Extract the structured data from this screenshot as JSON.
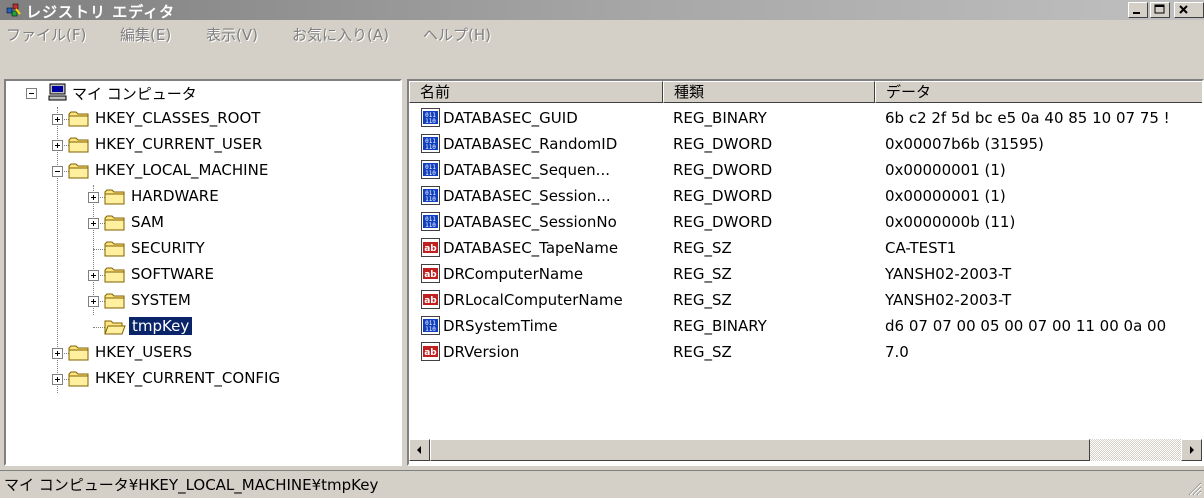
{
  "window": {
    "title": "レジストリ エディタ",
    "controls": {
      "minimize": "minimize",
      "maximize": "maximize",
      "close": "close"
    }
  },
  "menu": [
    {
      "label": "ファイル(F)"
    },
    {
      "label": "編集(E)"
    },
    {
      "label": "表示(V)"
    },
    {
      "label": "お気に入り(A)"
    },
    {
      "label": "ヘルプ(H)"
    }
  ],
  "tree": {
    "root": "マイ コンピュータ",
    "nodes": [
      {
        "label": "HKEY_CLASSES_ROOT",
        "expander": "plus"
      },
      {
        "label": "HKEY_CURRENT_USER",
        "expander": "plus"
      },
      {
        "label": "HKEY_LOCAL_MACHINE",
        "expander": "minus"
      },
      {
        "label": "HARDWARE",
        "expander": "plus"
      },
      {
        "label": "SAM",
        "expander": "plus"
      },
      {
        "label": "SECURITY",
        "expander": "none"
      },
      {
        "label": "SOFTWARE",
        "expander": "plus"
      },
      {
        "label": "SYSTEM",
        "expander": "plus"
      },
      {
        "label": "tmpKey",
        "expander": "none",
        "selected": true
      },
      {
        "label": "HKEY_USERS",
        "expander": "plus"
      },
      {
        "label": "HKEY_CURRENT_CONFIG",
        "expander": "plus"
      }
    ]
  },
  "list": {
    "columns": [
      "名前",
      "種類",
      "データ"
    ],
    "rows": [
      {
        "icon": "binary-value-icon",
        "name": "DATABASEC_GUID",
        "type": "REG_BINARY",
        "data": "6b c2 2f 5d bc e5 0a 40 85 10 07 75 !"
      },
      {
        "icon": "binary-value-icon",
        "name": "DATABASEC_RandomID",
        "type": "REG_DWORD",
        "data": "0x00007b6b (31595)"
      },
      {
        "icon": "binary-value-icon",
        "name": "DATABASEC_Sequen...",
        "type": "REG_DWORD",
        "data": "0x00000001 (1)"
      },
      {
        "icon": "binary-value-icon",
        "name": "DATABASEC_Session...",
        "type": "REG_DWORD",
        "data": "0x00000001 (1)"
      },
      {
        "icon": "binary-value-icon",
        "name": "DATABASEC_SessionNo",
        "type": "REG_DWORD",
        "data": "0x0000000b (11)"
      },
      {
        "icon": "string-value-icon",
        "name": "DATABASEC_TapeName",
        "type": "REG_SZ",
        "data": "CA-TEST1"
      },
      {
        "icon": "string-value-icon",
        "name": "DRComputerName",
        "type": "REG_SZ",
        "data": "YANSH02-2003-T"
      },
      {
        "icon": "string-value-icon",
        "name": "DRLocalComputerName",
        "type": "REG_SZ",
        "data": "YANSH02-2003-T"
      },
      {
        "icon": "binary-value-icon",
        "name": "DRSystemTime",
        "type": "REG_BINARY",
        "data": "d6 07 07 00 05 00 07 00 11 00 0a 00"
      },
      {
        "icon": "string-value-icon",
        "name": "DRVersion",
        "type": "REG_SZ",
        "data": "7.0"
      }
    ]
  },
  "status": {
    "text": "マイ コンピュータ¥HKEY_LOCAL_MACHINE¥tmpKey"
  },
  "colors": {
    "selection": "#0a246a",
    "titlebar": "#808080",
    "face": "#d4d0c8"
  }
}
